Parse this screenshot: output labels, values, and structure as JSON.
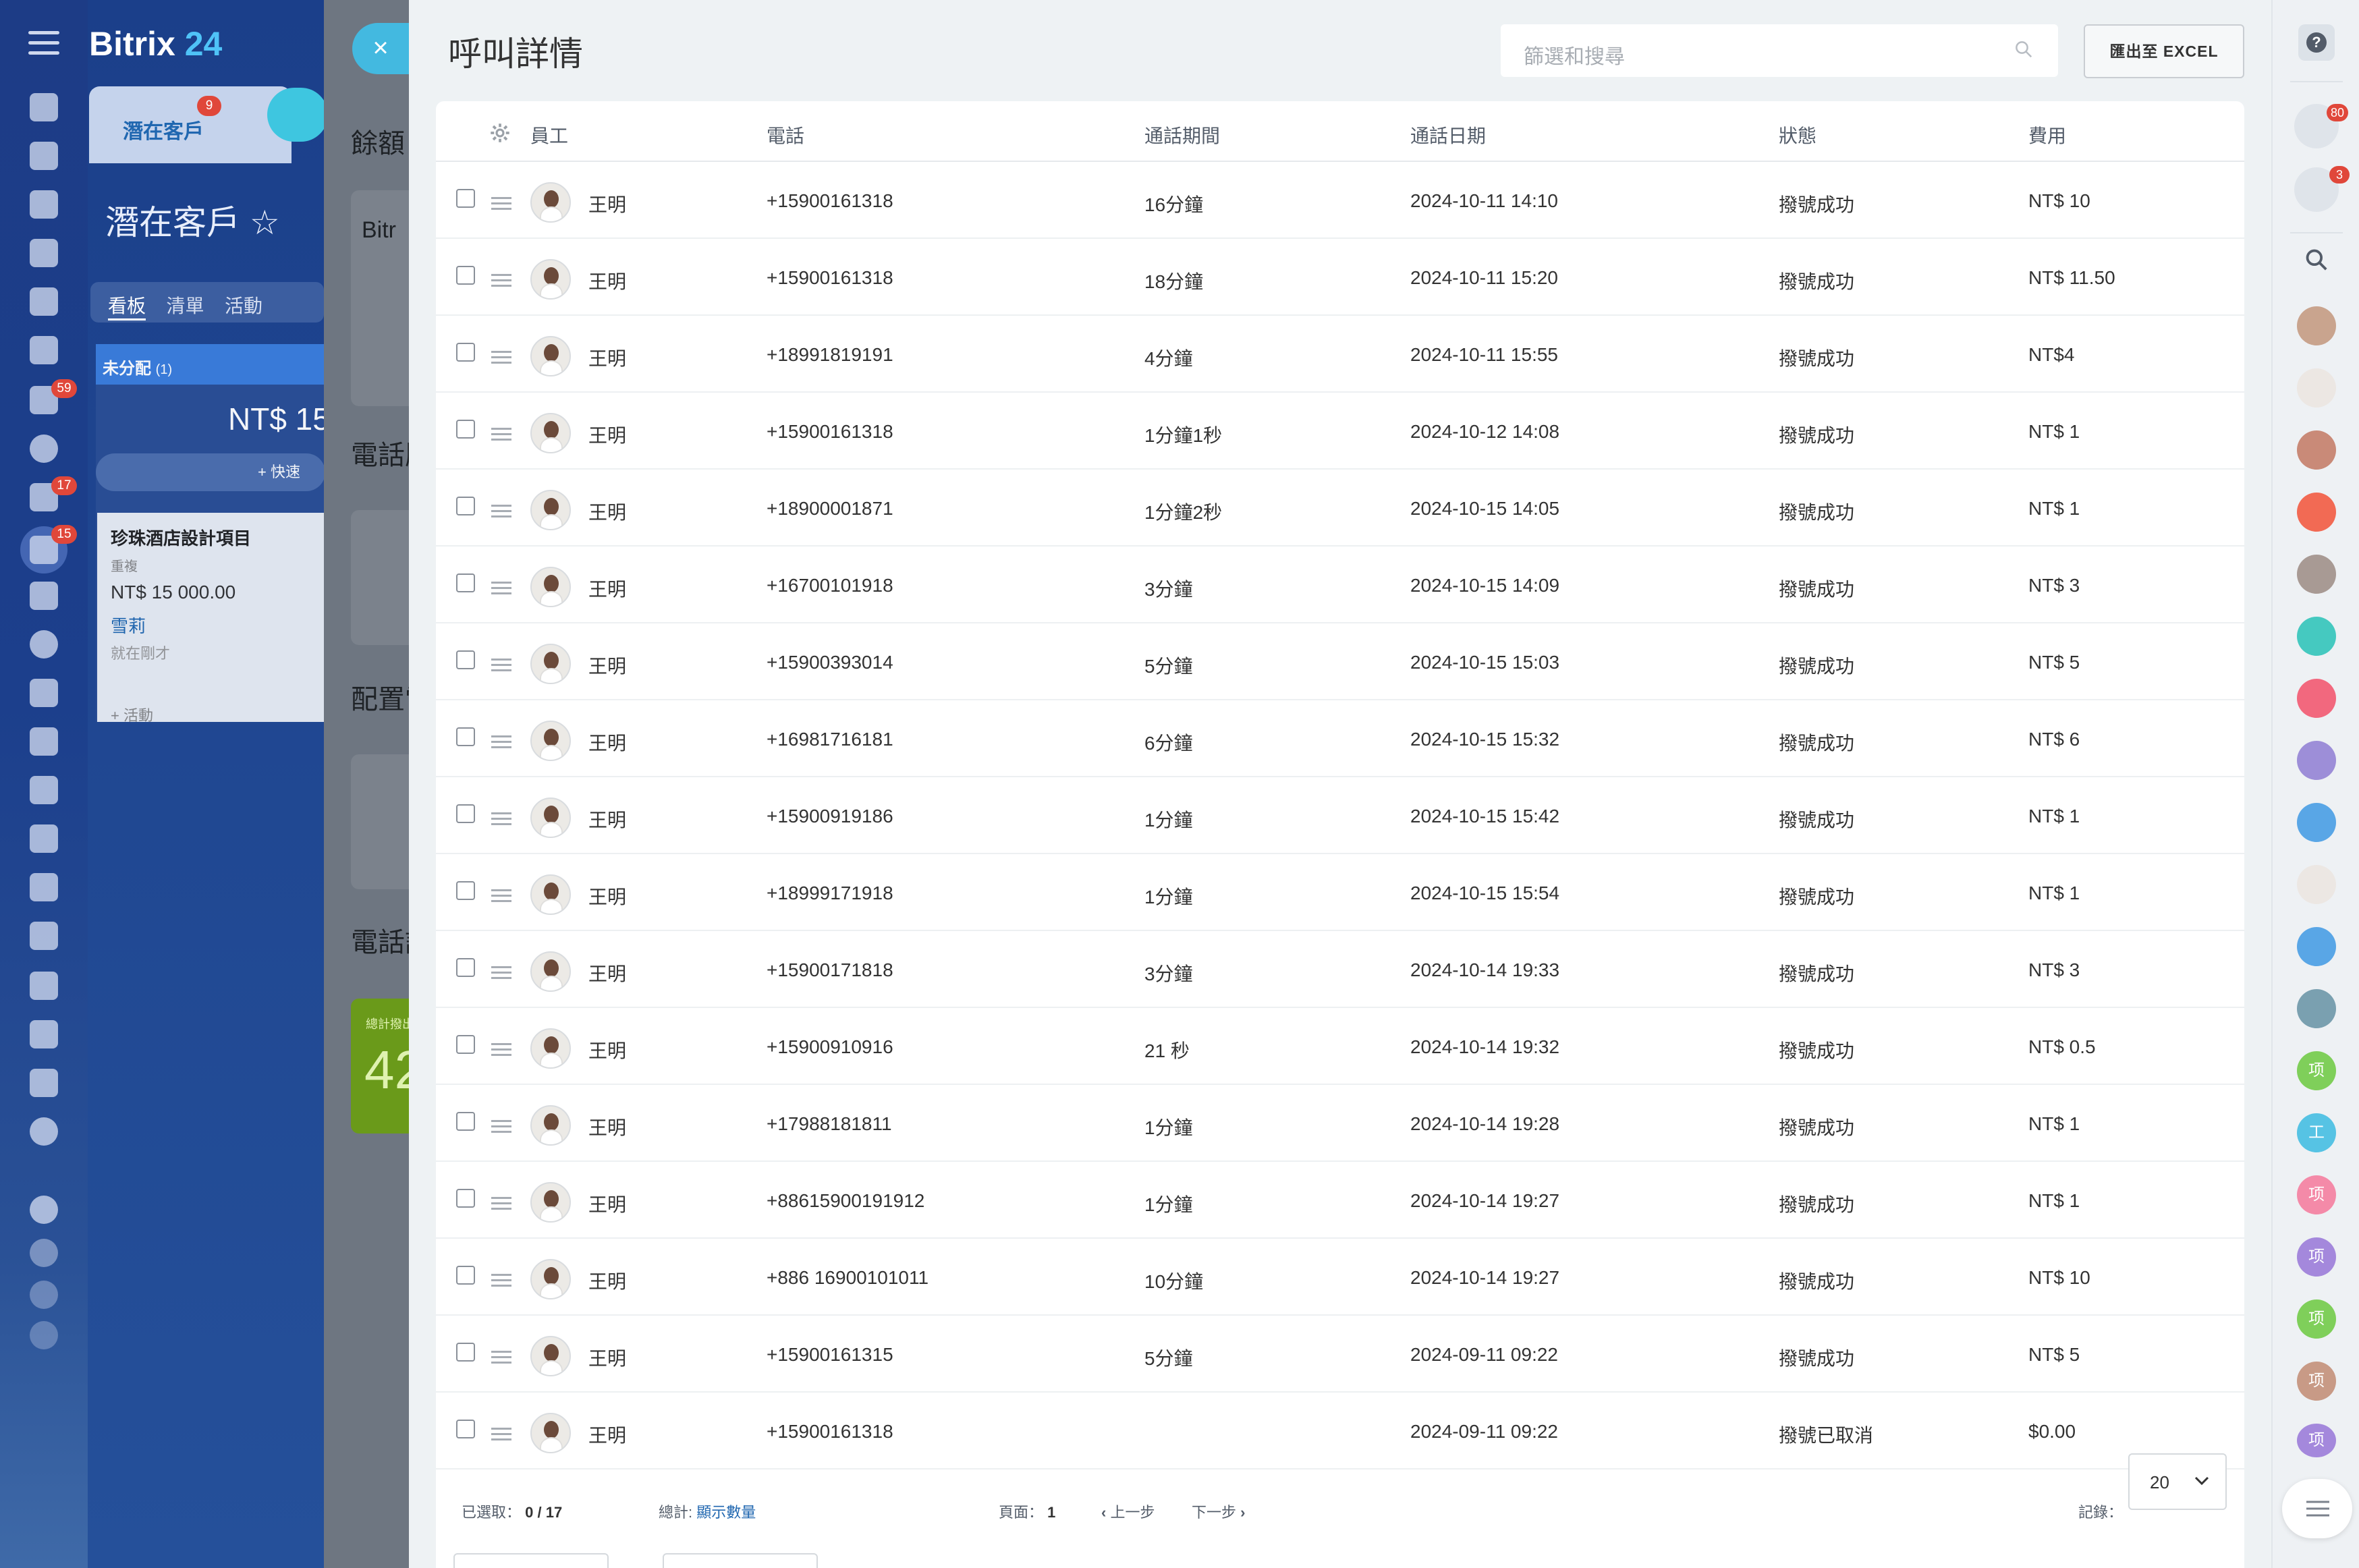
{
  "app": {
    "logo_text": "Bitrix",
    "logo_num": "24"
  },
  "leftnav": {
    "badges": [
      "59",
      "17",
      "15"
    ]
  },
  "crm": {
    "tab_label": "潛在客戶",
    "tab_badge": "9",
    "page_title": "潛在客戶",
    "views": [
      "看板",
      "清單",
      "活動"
    ],
    "column_title": "未分配",
    "column_count": "(1)",
    "column_total": "NT$ 15",
    "quick_add": "快速",
    "card": {
      "title": "珍珠酒店設計項目",
      "subtitle": "重複",
      "amount": "NT$ 15 000.00",
      "person": "雪莉",
      "time": "就在剛才",
      "activity": "+ 活動"
    }
  },
  "mid": {
    "close_glyph": "×",
    "labels": [
      "餘額",
      "Bitr",
      "電話服",
      "配置電",
      "電話記"
    ],
    "green_label": "總計撥出",
    "green_value": "42"
  },
  "panel": {
    "title": "呼叫詳情",
    "search_placeholder": "篩選和搜尋",
    "export_label": "匯出至 EXCEL"
  },
  "table": {
    "headers": {
      "employee": "員工",
      "phone": "電話",
      "duration": "通話期間",
      "date": "通話日期",
      "status": "狀態",
      "cost": "費用"
    },
    "rows": [
      {
        "employee": "王明",
        "phone": "+15900161318",
        "duration": "16分鐘",
        "date": "2024-10-11 14:10",
        "status": "撥號成功",
        "cost": "NT$ 10"
      },
      {
        "employee": "王明",
        "phone": "+15900161318",
        "duration": "18分鐘",
        "date": "2024-10-11 15:20",
        "status": "撥號成功",
        "cost": "NT$ 11.50"
      },
      {
        "employee": "王明",
        "phone": "+18991819191",
        "duration": "4分鐘",
        "date": "2024-10-11 15:55",
        "status": "撥號成功",
        "cost": "NT$4"
      },
      {
        "employee": "王明",
        "phone": "+15900161318",
        "duration": "1分鐘1秒",
        "date": "2024-10-12 14:08",
        "status": "撥號成功",
        "cost": "NT$ 1"
      },
      {
        "employee": "王明",
        "phone": "+18900001871",
        "duration": "1分鐘2秒",
        "date": "2024-10-15 14:05",
        "status": "撥號成功",
        "cost": "NT$ 1"
      },
      {
        "employee": "王明",
        "phone": "+16700101918",
        "duration": "3分鐘",
        "date": "2024-10-15 14:09",
        "status": "撥號成功",
        "cost": "NT$ 3"
      },
      {
        "employee": "王明",
        "phone": "+15900393014",
        "duration": "5分鐘",
        "date": "2024-10-15 15:03",
        "status": "撥號成功",
        "cost": "NT$ 5"
      },
      {
        "employee": "王明",
        "phone": "+16981716181",
        "duration": "6分鐘",
        "date": "2024-10-15 15:32",
        "status": "撥號成功",
        "cost": "NT$ 6"
      },
      {
        "employee": "王明",
        "phone": "+15900919186",
        "duration": "1分鐘",
        "date": "2024-10-15 15:42",
        "status": "撥號成功",
        "cost": "NT$ 1"
      },
      {
        "employee": "王明",
        "phone": "+18999171918",
        "duration": "1分鐘",
        "date": "2024-10-15 15:54",
        "status": "撥號成功",
        "cost": "NT$ 1"
      },
      {
        "employee": "王明",
        "phone": "+15900171818",
        "duration": "3分鐘",
        "date": "2024-10-14 19:33",
        "status": "撥號成功",
        "cost": "NT$ 3"
      },
      {
        "employee": "王明",
        "phone": "+15900910916",
        "duration": "21 秒",
        "date": "2024-10-14 19:32",
        "status": "撥號成功",
        "cost": "NT$ 0.5"
      },
      {
        "employee": "王明",
        "phone": "+17988181811",
        "duration": "1分鐘",
        "date": "2024-10-14 19:28",
        "status": "撥號成功",
        "cost": "NT$ 1"
      },
      {
        "employee": "王明",
        "phone": "+88615900191912",
        "duration": "1分鐘",
        "date": "2024-10-14 19:27",
        "status": "撥號成功",
        "cost": "NT$ 1"
      },
      {
        "employee": "王明",
        "phone": "+886 16900101011",
        "duration": "10分鐘",
        "date": "2024-10-14 19:27",
        "status": "撥號成功",
        "cost": "NT$ 10"
      },
      {
        "employee": "王明",
        "phone": "+15900161315",
        "duration": "5分鐘",
        "date": "2024-09-11 09:22",
        "status": "撥號成功",
        "cost": "NT$ 5"
      },
      {
        "employee": "王明",
        "phone": "+15900161318",
        "duration": "",
        "date": "2024-09-11 09:22",
        "status": "撥號已取消",
        "cost": "$0.00"
      }
    ]
  },
  "footer": {
    "selected_label": "已選取：",
    "selected_value": "0 / 17",
    "total_label": "總計:",
    "total_link": "顯示數量",
    "page_label": "頁面：",
    "page_value": "1",
    "prev_label": "上一步",
    "next_label": "下一步",
    "records_label": "記錄：",
    "page_size": "20"
  },
  "rightbar": {
    "help_glyph": "?",
    "notif_badge": "80",
    "chat_badge": "3",
    "avatar_letters": [
      "项",
      "工",
      "项",
      "项",
      "项",
      "项",
      "项"
    ]
  },
  "colors": {
    "accent_blue": "#2067b0",
    "sky": "#43b9e0",
    "danger": "#e0473a",
    "panel_bg": "#eef2f4"
  }
}
